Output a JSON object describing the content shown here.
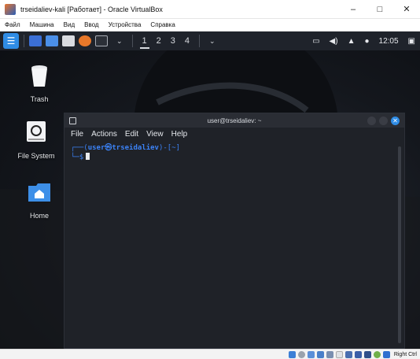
{
  "vbox": {
    "title": "trseidaliev-kali [Работает] - Oracle VirtualBox",
    "window_controls": {
      "minimize": "–",
      "maximize": "□",
      "close": "✕"
    },
    "menu": [
      "Файл",
      "Машина",
      "Вид",
      "Ввод",
      "Устройства",
      "Справка"
    ],
    "status": {
      "host_key": "Right Ctrl"
    }
  },
  "kali_panel": {
    "workspaces": [
      "1",
      "2",
      "3",
      "4"
    ],
    "active_workspace": "1",
    "clock": "12:05",
    "icons": [
      "kali-menu-icon",
      "files-icon",
      "folder-icon",
      "text-editor-icon",
      "firefox-icon",
      "terminal-icon",
      "dropdown-icon",
      "display-icon",
      "volume-icon",
      "bell-icon",
      "clock-icon",
      "lock-icon"
    ]
  },
  "desktop": {
    "icons": [
      {
        "label": "Trash"
      },
      {
        "label": "File System"
      },
      {
        "label": "Home"
      }
    ]
  },
  "terminal": {
    "title": "user@trseidaliev: ~",
    "menu": [
      "File",
      "Actions",
      "Edit",
      "View",
      "Help"
    ],
    "prompt": {
      "prefix": "┌──(",
      "user_host": "user㉿trseidaliev",
      "suffix": ")-[~]",
      "line2": "└─$"
    }
  },
  "colors": {
    "kali_blue": "#2f8ce5",
    "prompt_blue": "#3b82f6",
    "terminal_bg": "#1f2228",
    "panel_bg": "#1f232b"
  }
}
